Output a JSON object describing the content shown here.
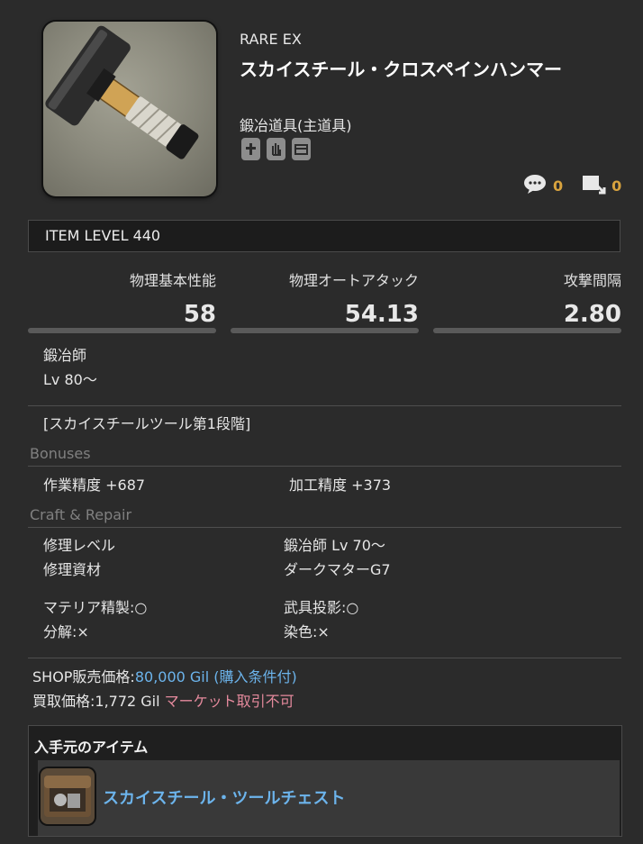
{
  "item": {
    "rarity": "RARE EX",
    "name": "スカイスチール・クロスペインハンマー",
    "category": "鍛冶道具(主道具)",
    "flag_icons": [
      "plus-shield-icon",
      "hand-glove-icon",
      "storage-chest-icon"
    ],
    "comment_count": "0",
    "loadstone_count": "0"
  },
  "item_level": "ITEM LEVEL 440",
  "stats": [
    {
      "label": "物理基本性能",
      "value": "58"
    },
    {
      "label": "物理オートアタック",
      "value": "54.13"
    },
    {
      "label": "攻撃間隔",
      "value": "2.80"
    }
  ],
  "requirement": {
    "job": "鍛冶師",
    "level": "Lv 80〜"
  },
  "series": "[スカイスチールツール第1段階]",
  "bonuses": {
    "heading": "Bonuses",
    "items": [
      {
        "label": "作業精度",
        "value": "+687"
      },
      {
        "label": "加工精度",
        "value": "+373"
      }
    ]
  },
  "craft_repair": {
    "heading": "Craft & Repair",
    "repair_level_label": "修理レベル",
    "repair_level_value": "鍛冶師 Lv 70〜",
    "repair_material_label": "修理資材",
    "repair_material_value": "ダークマターG7",
    "materia_label": "マテリア精製:○",
    "glamour_label": "武具投影:○",
    "desynth_label": "分解:×",
    "dye_label": "染色:×"
  },
  "prices": {
    "shop_label": "SHOP販売価格:",
    "shop_value": "80,000 Gil",
    "shop_note": "(購入条件付)",
    "sell_label": "買取価格:1,772 Gil",
    "market_note": "マーケット取引不可"
  },
  "obtain": {
    "heading": "入手元のアイテム",
    "item_name": "スカイスチール・ツールチェスト"
  },
  "colors": {
    "background": "#2b2b2b",
    "link_blue": "#6cb4ec",
    "warning_pink": "#e58a9d",
    "count_gold": "#d8a33e"
  }
}
